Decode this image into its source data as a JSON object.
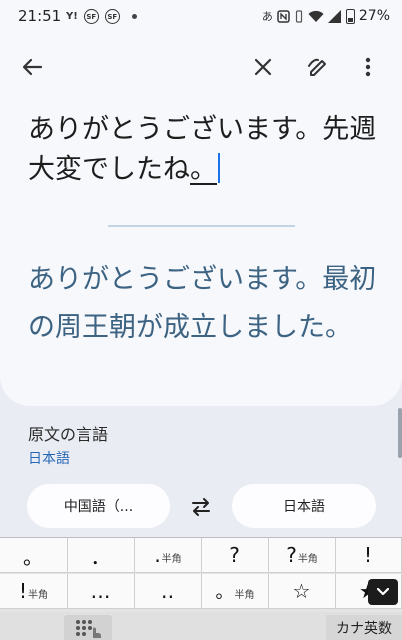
{
  "status_bar": {
    "time": "21:51",
    "icon_y": "Y!",
    "icon_sf1": "SF",
    "icon_sf2": "SF",
    "ime_indicator": "あ",
    "battery_percent": "27%"
  },
  "source": {
    "text_main": "ありがとうございます。先週大変でしたね",
    "text_tail": "。"
  },
  "translation": {
    "text": "ありがとうございます。最初の周王朝が成立しました。"
  },
  "language_section": {
    "label": "原文の言語",
    "detected": "日本語"
  },
  "language_pills": {
    "from": "中国語（...",
    "to": "日本語"
  },
  "keyboard": {
    "row1": [
      {
        "main": "。",
        "sub": ""
      },
      {
        "main": "．",
        "sub": ""
      },
      {
        "main": ".",
        "sub": "半角"
      },
      {
        "main": "?",
        "sub": ""
      },
      {
        "main": "?",
        "sub": "半角"
      },
      {
        "main": "!",
        "sub": ""
      }
    ],
    "row2": [
      {
        "main": "!",
        "sub": "半角"
      },
      {
        "main": "…",
        "sub": ""
      },
      {
        "main": "‥",
        "sub": ""
      },
      {
        "main": "。",
        "sub": "半角"
      },
      {
        "main": "☆",
        "sub": ""
      },
      {
        "main": "★",
        "sub": ""
      }
    ],
    "kana_label": "カナ英数"
  }
}
